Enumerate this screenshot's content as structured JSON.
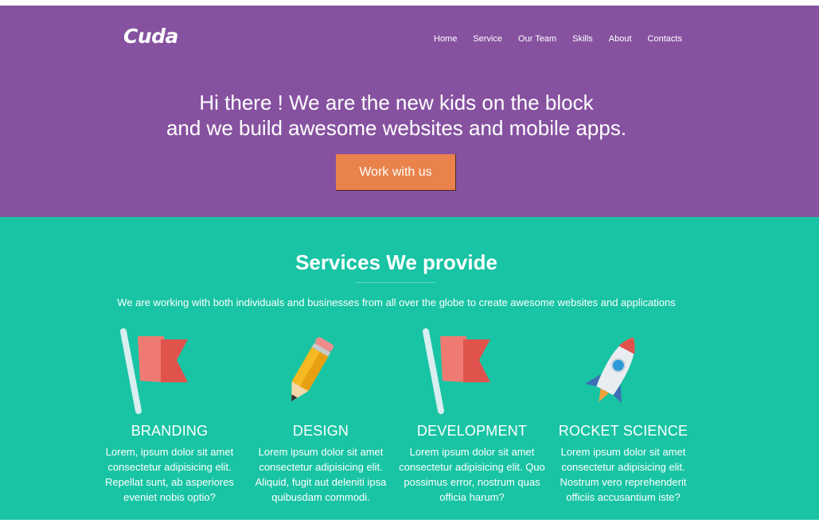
{
  "header": {
    "logo": "Cuda",
    "nav": [
      "Home",
      "Service",
      "Our Team",
      "Skills",
      "About",
      "Contacts"
    ]
  },
  "hero": {
    "line1": "Hi there ! We are the new kids on the block",
    "line2": "and we build awesome websites and mobile apps.",
    "cta_label": "Work with us"
  },
  "services": {
    "title": "Services We provide",
    "subtitle": "We are working with both individuals and businesses from all over the globe to create awesome websites and applications",
    "items": [
      {
        "icon": "flag-icon",
        "title": "BRANDING",
        "text": "Lorem, ipsum dolor sit amet consectetur adipisicing elit. Repellat sunt, ab asperiores eveniet nobis optio?"
      },
      {
        "icon": "pencil-icon",
        "title": "DESIGN",
        "text": "Lorem ipsum dolor sit amet consectetur adipisicing elit. Aliquid, fugit aut deleniti ipsa quibusdam commodi."
      },
      {
        "icon": "flag-icon",
        "title": "DEVELOPMENT",
        "text": "Lorem ipsum dolor sit amet consectetur adipisicing elit. Quo possimus error, nostrum quas officia harum?"
      },
      {
        "icon": "rocket-icon",
        "title": "ROCKET SCIENCE",
        "text": "Lorem ipsum dolor sit amet consectetur adipisicing elit. Nostrum vero reprehenderit officiis accusantium iste?"
      }
    ]
  },
  "colors": {
    "hero_bg": "#8652a0",
    "services_bg": "#19c4a4",
    "cta_bg": "#e9824b"
  }
}
